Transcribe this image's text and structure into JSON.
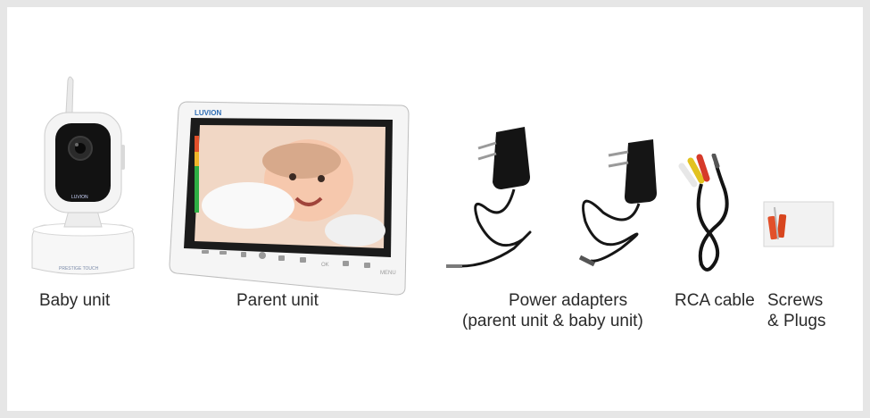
{
  "items": {
    "baby_unit": {
      "caption": "Baby unit",
      "front_label": "LUVION",
      "base_label": "PRESTIGE TOUCH"
    },
    "parent_unit": {
      "caption": "Parent unit",
      "brand": "LUVION",
      "button_ok": "OK",
      "button_menu": "MENU"
    },
    "power_adapters": {
      "caption_line1": "Power adapters",
      "caption_line2": "(parent unit & baby unit)"
    },
    "rca_cable": {
      "caption": "RCA cable"
    },
    "screws_plugs": {
      "caption_line1": "Screws",
      "caption_line2": "& Plugs"
    }
  },
  "colors": {
    "background": "#e6e6e6",
    "panel": "#ffffff",
    "device_white": "#f4f4f4",
    "device_black": "#111111",
    "screen_border": "#1a1a1a",
    "plug_orange": "#e2502a"
  }
}
